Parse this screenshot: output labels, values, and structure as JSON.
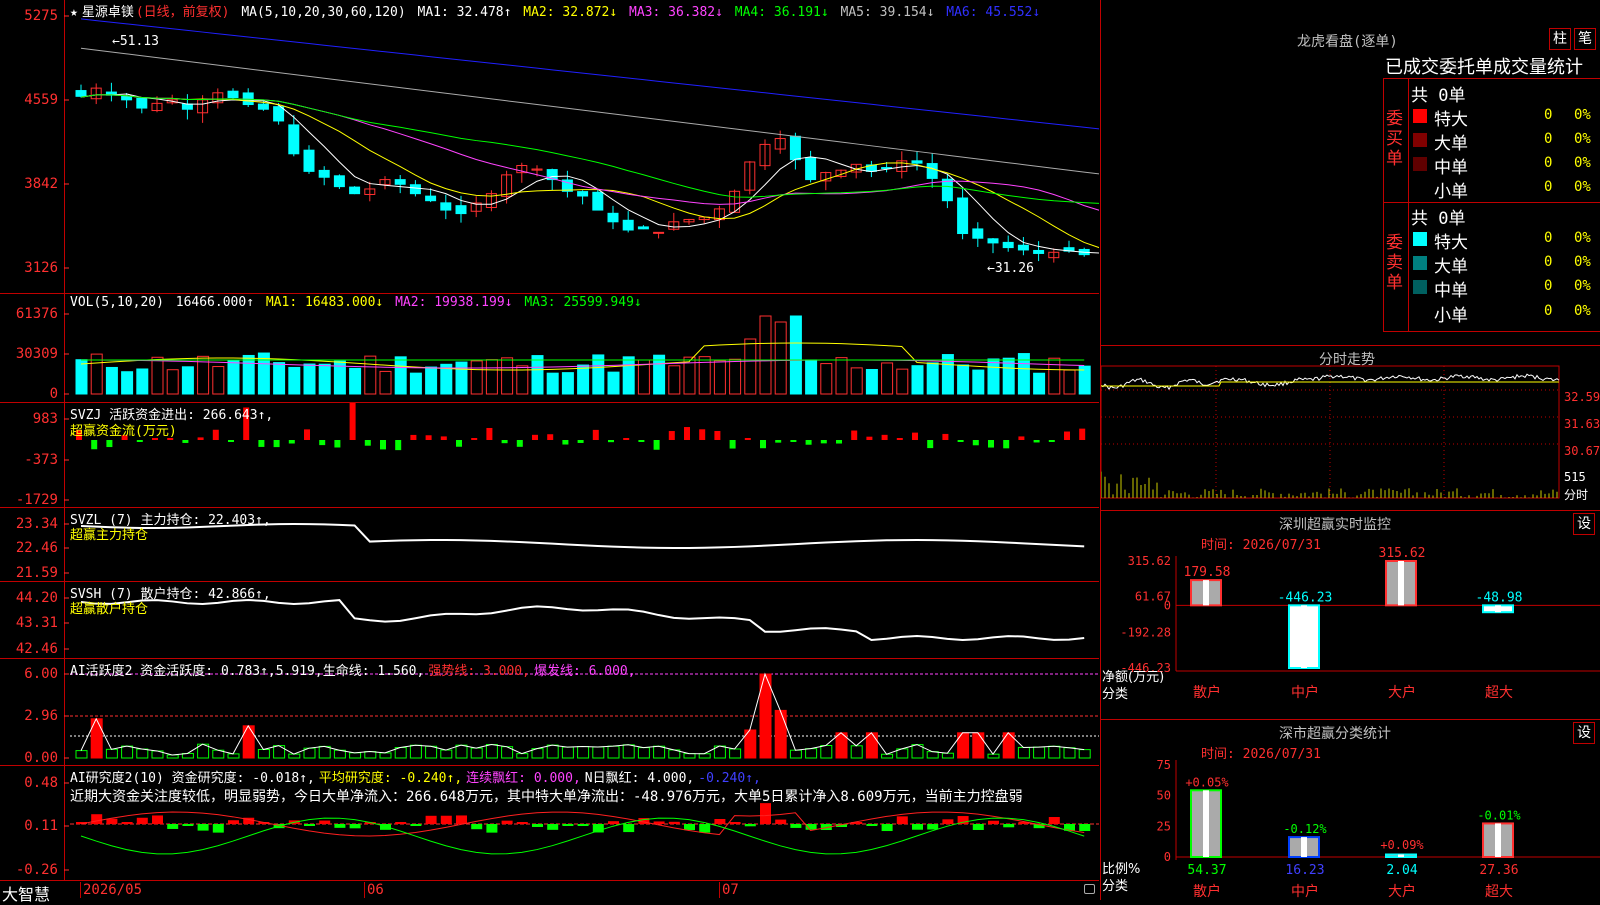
{
  "stock": {
    "star": "★",
    "name": "星源卓镁",
    "period": "(日线，前复权)",
    "ma_label": "MA(5,10,20,30,60,120)",
    "ma": [
      {
        "label": "MA1: 32.478↑",
        "color": "#ffffff"
      },
      {
        "label": "MA2: 32.872↓",
        "color": "#ffff00"
      },
      {
        "label": "MA3: 36.382↓",
        "color": "#ff44ff"
      },
      {
        "label": "MA4: 36.191↓",
        "color": "#00ff00"
      },
      {
        "label": "MA5: 39.154↓",
        "color": "#c0c0c0"
      },
      {
        "label": "MA6: 45.552↓",
        "color": "#3030ff"
      }
    ],
    "high_label": "←51.13",
    "low_label": "←31.26",
    "price_ticks": [
      "5275",
      "4559",
      "3842",
      "3126"
    ]
  },
  "vol": {
    "label": "VOL(5,10,20)",
    "value": "16466.000↑",
    "ma1": "MA1: 16483.000↓",
    "ma2": "MA2: 19938.199↓",
    "ma3": "MA3: 25599.949↓",
    "ticks": [
      "61376",
      "30309",
      "0"
    ]
  },
  "svzj": {
    "label": "SVZJ  活跃资金进出: 266.643↑,",
    "sub": "超赢资金流(万元)",
    "ticks": [
      "983",
      "-373",
      "-1729"
    ]
  },
  "svzl": {
    "label": "SVZL (7) 主力持仓: 22.403↑,",
    "sub": "超赢主力持仓",
    "ticks": [
      "23.34",
      "22.46",
      "21.59"
    ]
  },
  "svsh": {
    "label": "SVSH (7) 散户持仓: 42.866↑,",
    "sub": "超赢散户持仓",
    "ticks": [
      "44.20",
      "43.31",
      "42.46"
    ]
  },
  "ai1": {
    "label": "AI活跃度2 资金活跃度: 0.783↑,5.919,生命线: 1.560,",
    "strong": "强势线: 3.000,",
    "burst": "爆发线: 6.000,",
    "ticks": [
      "6.00",
      "2.96",
      "0.00"
    ]
  },
  "ai2": {
    "label": "AI研究度2(10) 资金研究度: -0.018↑,",
    "avg": "平均研究度: -0.240↑,",
    "red": "连续飘红: 0.000,",
    "nred": "N日飘红: 4.000,",
    "last": "-0.240↑,",
    "desc": "近期大资金关注度较低，明显弱势，今日大单净流入：266.648万元，其中特大单净流出：-48.976万元，大单5日累计净入8.609万元，当前主力控盘弱",
    "ticks": [
      "0.48",
      "0.11",
      "-0.26"
    ]
  },
  "bottom": {
    "logo": "大智慧",
    "dates": [
      "2026/05",
      "06",
      "07"
    ]
  },
  "lhb": {
    "title": "龙虎看盘(逐单)",
    "btn1": "柱",
    "btn2": "笔",
    "subtitle": "已成交委托单成交量统计",
    "buy_total": "共 0单",
    "sell_total": "共 0单",
    "buy_side": "委买单",
    "sell_side": "委卖单",
    "rows": [
      {
        "name": "特大",
        "val": "0",
        "pct": "0%"
      },
      {
        "name": "大单",
        "val": "0",
        "pct": "0%"
      },
      {
        "name": "中单",
        "val": "0",
        "pct": "0%"
      },
      {
        "name": "小单",
        "val": "0",
        "pct": "0%"
      }
    ],
    "buy_colors": [
      "#ff0000",
      "#800000",
      "#600000",
      "#000000"
    ],
    "sell_colors": [
      "#00ffff",
      "#008080",
      "#006060",
      "#000000"
    ]
  },
  "fs": {
    "title": "分时走势",
    "ticks": [
      "32.59",
      "31.63",
      "30.67",
      "515",
      "分时"
    ]
  },
  "sz": {
    "title": "深圳超赢实时监控",
    "btn": "设",
    "time": "时间: 2026/07/31",
    "ticks": [
      "315.62",
      "61.67",
      "0",
      "-192.28",
      "-446.23"
    ],
    "unit": "净额(万元)",
    "cat_label": "分类",
    "cats": [
      "散户",
      "中户",
      "大户",
      "超大"
    ],
    "values": [
      179.58,
      -446.23,
      315.62,
      -48.98
    ],
    "labels": [
      "179.58",
      "-446.23",
      "315.62",
      "-48.98"
    ]
  },
  "sc": {
    "title": "深市超赢分类统计",
    "btn": "设",
    "time": "时间: 2026/07/31",
    "ticks": [
      "75",
      "50",
      "25",
      "0"
    ],
    "unit": "比例%",
    "cat_label": "分类",
    "cats": [
      "散户",
      "中户",
      "大户",
      "超大"
    ],
    "values": [
      54.37,
      16.23,
      2.04,
      27.36
    ],
    "labels": [
      "54.37",
      "16.23",
      "2.04",
      "27.36"
    ],
    "changes": [
      "+0.05%",
      "-0.12%",
      "+0.09%",
      "-0.01%"
    ]
  }
}
